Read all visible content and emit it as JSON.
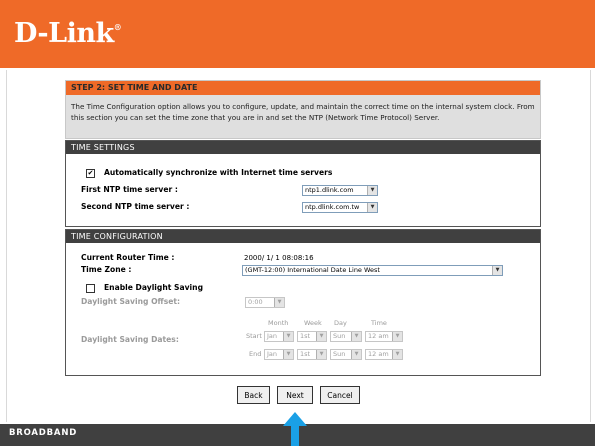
{
  "brand": {
    "logo": "D-Link",
    "reg_mark": "®"
  },
  "step": {
    "title": "STEP 2: SET TIME AND DATE",
    "text": "The Time Configuration option allows you to configure, update, and maintain the correct time on the internal system clock. From this section you can set the time zone that you are in and set the NTP (Network Time Protocol) Server."
  },
  "time_settings": {
    "header": "TIME SETTINGS",
    "auto_sync_label": "Automatically synchronize with Internet time servers",
    "auto_sync_checked": true,
    "first_ntp_label": "First NTP time server :",
    "first_ntp_value": "ntp1.dlink.com",
    "second_ntp_label": "Second NTP time server :",
    "second_ntp_value": "ntp.dlink.com.tw"
  },
  "time_config": {
    "header": "TIME CONFIGURATION",
    "router_time_label": "Current Router Time :",
    "router_time_value": "2000/ 1/ 1 08:08:16",
    "time_zone_label": "Time Zone :",
    "time_zone_value": "(GMT-12:00) International Date Line West",
    "dst_enable_label": "Enable Daylight Saving",
    "dst_enable_checked": false,
    "dst_offset_label": "Daylight Saving Offset:",
    "dst_offset_value": "0:00",
    "dst_dates_label": "Daylight Saving Dates:",
    "col_month": "Month",
    "col_week": "Week",
    "col_day": "Day",
    "col_time": "Time",
    "start_label": "Start",
    "end_label": "End",
    "start": {
      "month": "Jan",
      "week": "1st",
      "day": "Sun",
      "time": "12 am"
    },
    "end": {
      "month": "Jan",
      "week": "1st",
      "day": "Sun",
      "time": "12 am"
    }
  },
  "buttons": {
    "back": "Back",
    "next": "Next",
    "cancel": "Cancel"
  },
  "footer": {
    "label": "BROADBAND"
  },
  "colors": {
    "brand_orange": "#ef6a28",
    "dark_bar": "#404040",
    "arrow_blue": "#1aa0e6"
  },
  "icons": {
    "dropdown": "chevron-down-icon",
    "pointer": "arrow-up-icon"
  }
}
